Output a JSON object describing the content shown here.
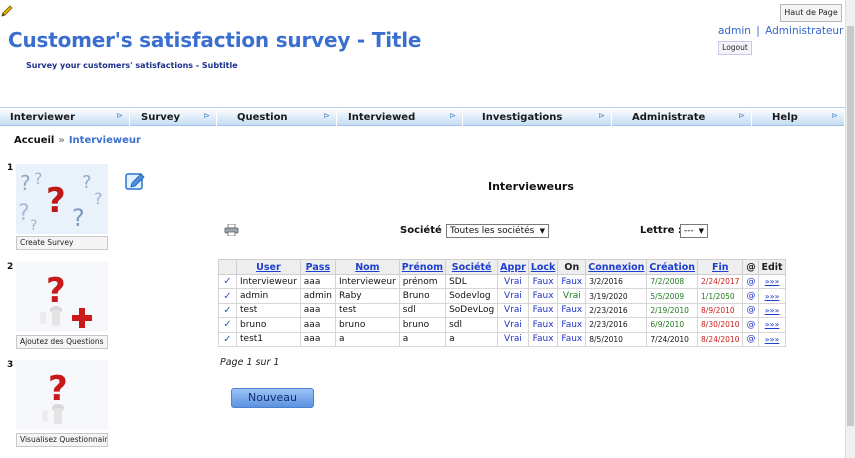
{
  "top_button_label": "Haut de Page",
  "header": {
    "title": "Customer's satisfaction survey - Title",
    "subtitle": "Survey your customers' satisfactions - Subtitle",
    "user_link": "admin",
    "separator": "|",
    "role_link": "Administrateur",
    "logout_label": "Logout"
  },
  "menu": [
    {
      "label": "Interviewer"
    },
    {
      "label": "Survey"
    },
    {
      "label": "Question"
    },
    {
      "label": "Interviewed"
    },
    {
      "label": "Investigations"
    },
    {
      "label": "Administrate"
    },
    {
      "label": "Help"
    }
  ],
  "breadcrumb": {
    "home": "Accueil",
    "separator": "»",
    "current": "Intervieweur"
  },
  "steps": [
    {
      "number": "1",
      "caption": "Create Survey"
    },
    {
      "number": "2",
      "caption": "Ajoutez des Questions"
    },
    {
      "number": "3",
      "caption": "Visualisez Questionnair"
    }
  ],
  "page_heading": "Intervieweurs",
  "filters": {
    "societe_label": "Société :",
    "societe_value": "Toutes les sociétés",
    "lettre_label": "Lettre :",
    "lettre_value": "---"
  },
  "table": {
    "columns": [
      "",
      "User",
      "Pass",
      "Nom",
      "Prénom",
      "Société",
      "Appr",
      "Lock",
      "On",
      "Connexion",
      "Création",
      "Fin",
      "@",
      "Edit"
    ],
    "rows": [
      {
        "check": "✓",
        "user": "Intervieweur",
        "pass": "aaa",
        "nom": "Intervieweur",
        "prenom": "prénom",
        "societe": "SDL",
        "appr": "Vrai",
        "lock": "Faux",
        "on": "Faux",
        "connexion": "3/2/2016",
        "creation": "7/2/2008",
        "fin": "2/24/2017",
        "at": "@",
        "edit": "»»»"
      },
      {
        "check": "✓",
        "user": "admin",
        "pass": "admin",
        "nom": "Raby",
        "prenom": "Bruno",
        "societe": "Sodevlog",
        "appr": "Vrai",
        "lock": "Faux",
        "on": "Vrai",
        "connexion": "3/19/2020",
        "creation": "5/5/2009",
        "fin": "1/1/2050",
        "at": "@",
        "edit": "»»»"
      },
      {
        "check": "✓",
        "user": "test",
        "pass": "aaa",
        "nom": "test",
        "prenom": "sdl",
        "societe": "SoDevLog",
        "appr": "Vrai",
        "lock": "Faux",
        "on": "Faux",
        "connexion": "2/23/2016",
        "creation": "2/19/2010",
        "fin": "8/9/2010",
        "at": "@",
        "edit": "»»»"
      },
      {
        "check": "✓",
        "user": "bruno",
        "pass": "aaa",
        "nom": "bruno",
        "prenom": "bruno",
        "societe": "sdl",
        "appr": "Vrai",
        "lock": "Faux",
        "on": "Faux",
        "connexion": "2/23/2016",
        "creation": "6/9/2010",
        "fin": "8/30/2010",
        "at": "@",
        "edit": "»»»"
      },
      {
        "check": "✓",
        "user": "test1",
        "pass": "aaa",
        "nom": "a",
        "prenom": "a",
        "societe": "a",
        "appr": "Vrai",
        "lock": "Faux",
        "on": "Faux",
        "connexion": "8/5/2010",
        "creation": "7/24/2010",
        "fin": "8/24/2010",
        "at": "@",
        "edit": "»»»"
      }
    ]
  },
  "pagination": "Page 1 sur 1",
  "new_button_label": "Nouveau",
  "colors": {
    "title": "#3a6fcf",
    "menu_bg": "#dcebf9",
    "link": "#1c3fd0",
    "date_green": "#1d7c1d",
    "date_red": "#d11a1a"
  }
}
